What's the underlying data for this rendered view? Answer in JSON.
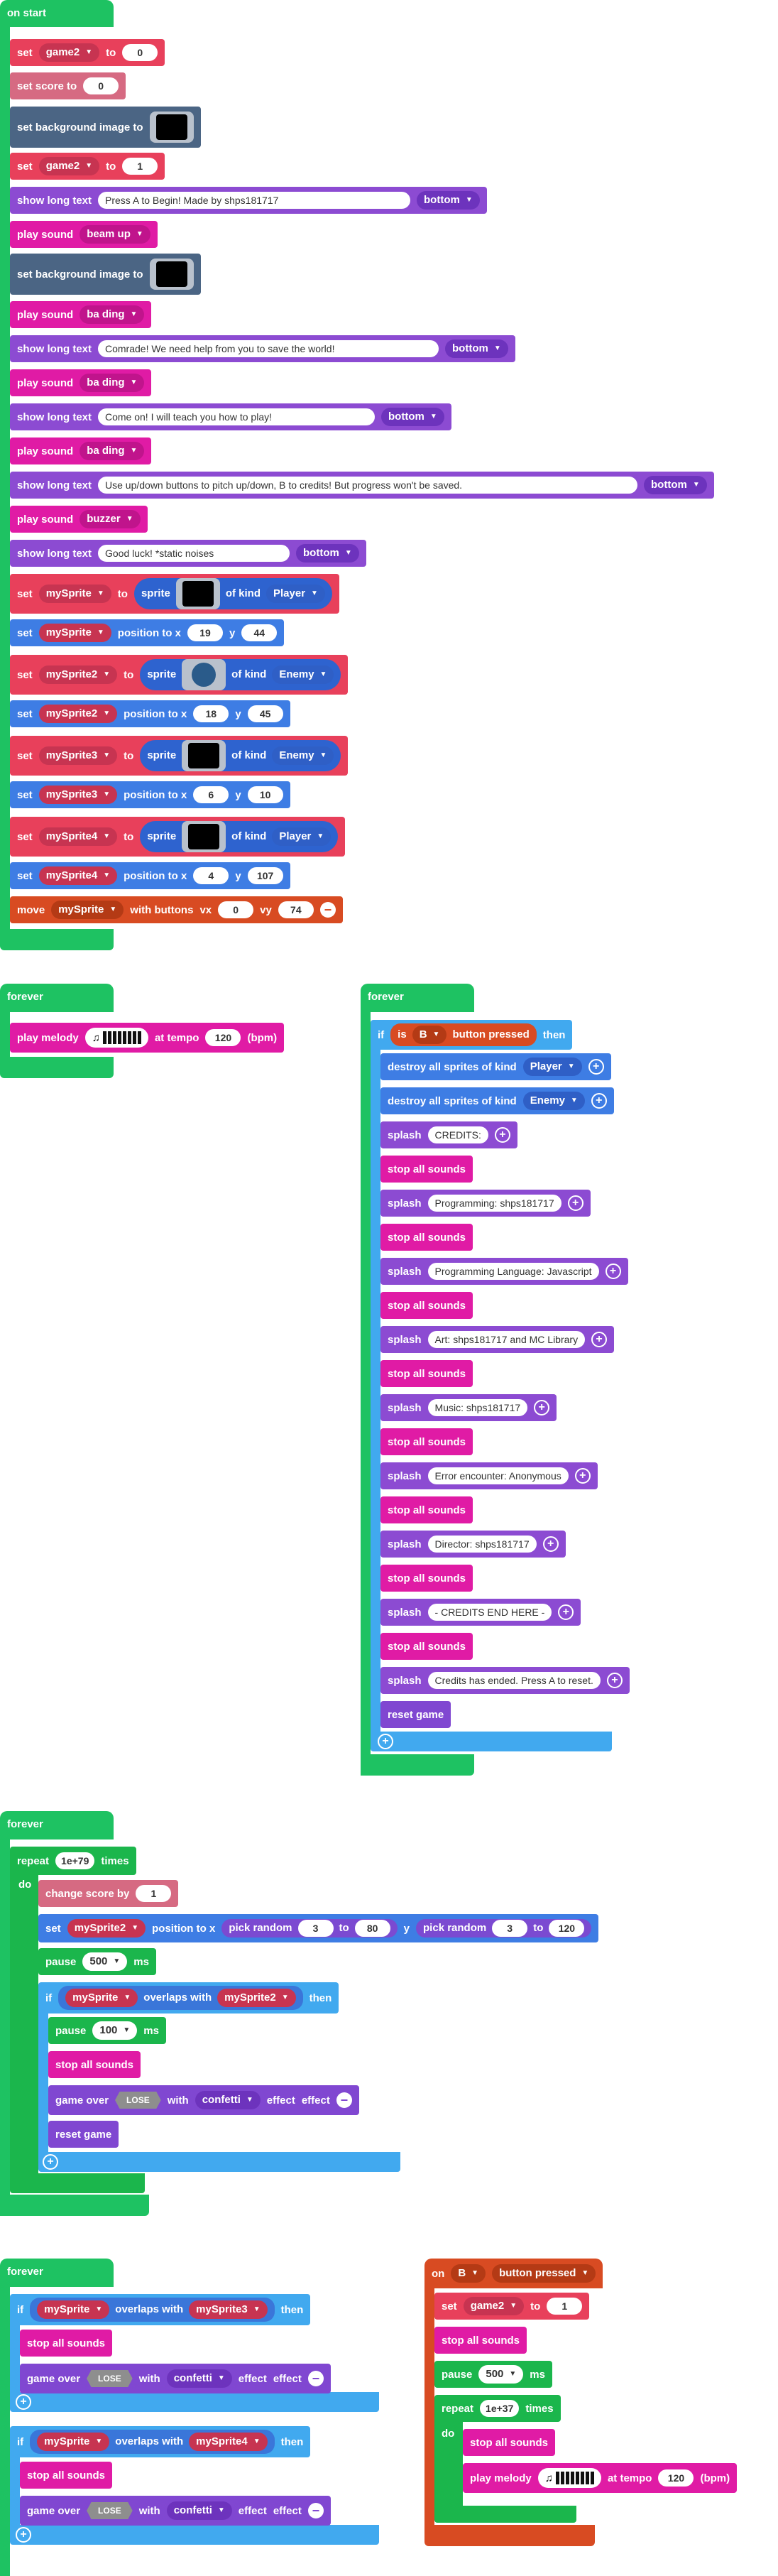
{
  "on_start": {
    "hat": "on start",
    "set": "set",
    "to": "to",
    "set_score_to": "set score to",
    "set_background_image_to": "set background image to",
    "show_long_text": "show long text",
    "play_sound": "play sound",
    "sprite": "sprite",
    "of_kind": "of kind",
    "position_to_x": "position to x",
    "y": "y",
    "move": "move",
    "with_buttons": "with buttons",
    "vx": "vx",
    "vy": "vy",
    "game2": "game2",
    "zero": "0",
    "one": "1",
    "bottom": "bottom",
    "msg1": "Press A to Begin!           Made by shps181717",
    "beam_up": "beam up",
    "ba_ding": "ba ding",
    "msg2": "Comrade! We need help from you to save the world!",
    "msg3": "Come on! I will teach you how to play!",
    "msg4": "Use up/down buttons to pitch up/down, B to credits! But progress won't be saved.",
    "buzzer": "buzzer",
    "msg5": "Good luck! *static noises",
    "mySprite": "mySprite",
    "mySprite2": "mySprite2",
    "mySprite3": "mySprite3",
    "mySprite4": "mySprite4",
    "Player": "Player",
    "Enemy": "Enemy",
    "pos1": [
      "19",
      "44"
    ],
    "pos2": [
      "18",
      "45"
    ],
    "pos3": [
      "6",
      "10"
    ],
    "pos4": [
      "4",
      "107"
    ],
    "vx_val": "0",
    "vy_val": "74"
  },
  "forever_melody": {
    "hat": "forever",
    "play_melody": "play melody",
    "at_tempo": "at tempo",
    "tempo": "120",
    "bpm": "(bpm)"
  },
  "credits": {
    "hat": "forever",
    "if": "if",
    "is": "is",
    "B": "B",
    "button_pressed": "button pressed",
    "then": "then",
    "destroy": "destroy all sprites of kind",
    "Player": "Player",
    "Enemy": "Enemy",
    "splash": "splash",
    "stop_all_sounds": "stop all sounds",
    "reset_game": "reset game",
    "lines": [
      "CREDITS:",
      "Programming: shps181717",
      "Programming Language: Javascript",
      "Art: shps181717 and MC Library",
      "Music: shps181717",
      "Error encounter: Anonymous",
      "Director: shps181717",
      "- CREDITS END HERE -",
      "Credits has ended. Press A to reset."
    ]
  },
  "loop3": {
    "hat": "forever",
    "repeat": "repeat",
    "times": "times",
    "repeat_val": "1e+79",
    "do": "do",
    "change_score_by": "change score by",
    "score_val": "1",
    "set": "set",
    "mySprite2": "mySprite2",
    "position_to_x": "position to x",
    "pick_random": "pick random",
    "to": "to",
    "y": "y",
    "rx": [
      "3",
      "80"
    ],
    "ry": [
      "3",
      "120"
    ],
    "pause": "pause",
    "ms": "ms",
    "pause1": "500",
    "pause2": "100",
    "if": "if",
    "mySprite": "mySprite",
    "overlaps_with": "overlaps with",
    "then": "then",
    "stop_all_sounds": "stop all sounds",
    "game_over": "game over",
    "lose": "LOSE",
    "with": "with",
    "confetti": "confetti",
    "effect": "effect",
    "reset_game": "reset game"
  },
  "loop4": {
    "hat": "forever",
    "if": "if",
    "mySprite": "mySprite",
    "overlaps_with": "overlaps with",
    "then": "then",
    "mySprite3": "mySprite3",
    "mySprite4": "mySprite4",
    "stop_all_sounds": "stop all sounds",
    "game_over": "game over",
    "lose": "LOSE",
    "with": "with",
    "confetti": "confetti",
    "effect": "effect"
  },
  "onB": {
    "on": "on",
    "B": "B",
    "button_pressed": "button pressed",
    "set": "set",
    "game2": "game2",
    "to": "to",
    "val": "1",
    "stop_all_sounds": "stop all sounds",
    "pause": "pause",
    "pause_val": "500",
    "ms": "ms",
    "repeat": "repeat",
    "repeat_val": "1e+37",
    "times": "times",
    "do": "do",
    "play_melody": "play melody",
    "at_tempo": "at tempo",
    "tempo": "120",
    "bpm": "(bpm)"
  },
  "colors": {
    "event": "#1ec262",
    "variables": "#e8405b",
    "scene": "#4b6584",
    "text": "#8c4bd2",
    "music": "#e01ba5",
    "sprites": "#3e7de4",
    "controller": "#d84b22",
    "logic": "#41a9ef",
    "game": "#8047d1"
  }
}
